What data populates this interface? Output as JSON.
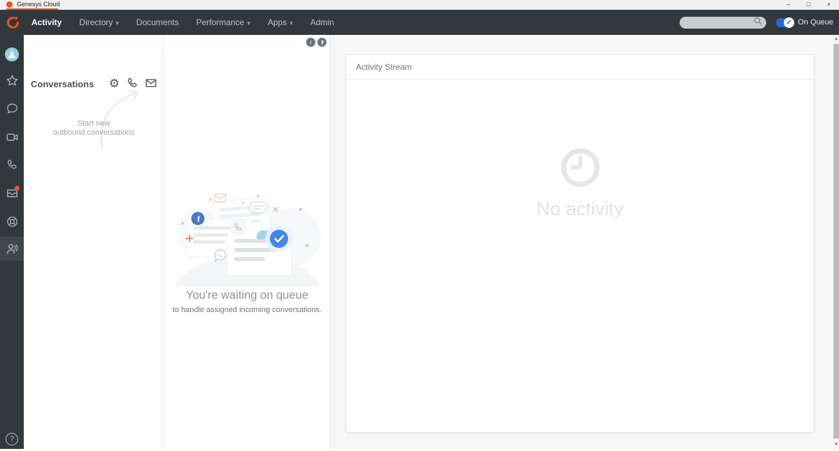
{
  "window": {
    "title": "Genesys Cloud"
  },
  "icons": {
    "caret_down": "▾",
    "minimize": "–",
    "restore": "□",
    "close": "×",
    "chevron_left": "‹",
    "gear": "⚙",
    "check": "✓",
    "question": "?",
    "scroll_up": "▴",
    "scroll_down": "▾"
  },
  "nav": {
    "items": [
      {
        "label": "Activity",
        "active": true
      },
      {
        "label": "Directory",
        "has_caret": true
      },
      {
        "label": "Documents"
      },
      {
        "label": "Performance",
        "has_caret": true
      },
      {
        "label": "Apps",
        "has_caret": true
      },
      {
        "label": "Admin"
      }
    ],
    "search": {
      "value": "",
      "placeholder": ""
    },
    "on_queue_label": "On Queue"
  },
  "sidebar": {
    "icons": [
      "profile-avatar",
      "favorites-star",
      "chat",
      "video",
      "calls-phone",
      "interactions-inbox",
      "support-buoy",
      "agents-people",
      "help"
    ],
    "unread_badge_on": "interactions-inbox",
    "selected": "agents-people"
  },
  "conversations": {
    "title": "Conversations",
    "hint_line1": "Start new",
    "hint_line2": "outbound conversations"
  },
  "queue": {
    "title": "You're waiting on queue",
    "subtitle": "to handle assigned incoming conversations."
  },
  "activity_stream": {
    "title": "Activity Stream",
    "empty_label": "No activity"
  },
  "colors": {
    "brand_orange": "#ff4f1f",
    "nav_dark": "#33383d",
    "accent_blue": "#2c66d4",
    "badge_orange": "#f2552e",
    "avatar_blue": "#8fd0e3"
  }
}
